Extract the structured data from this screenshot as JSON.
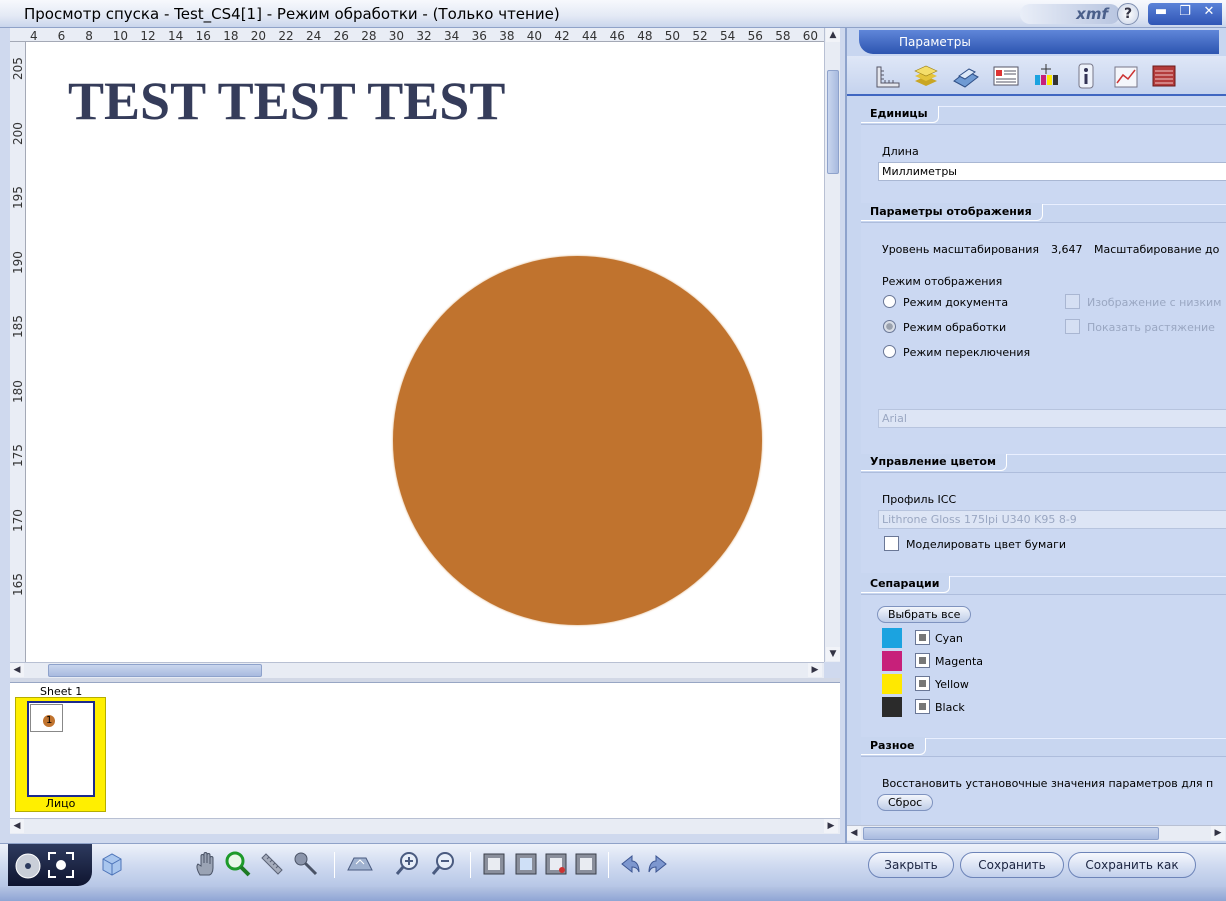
{
  "window": {
    "title": "Просмотр спуска - Test_CS4[1] - Режим обработки - (Только чтение)",
    "logo": "xmf",
    "help": "?",
    "controls": [
      "▬",
      "❐",
      "✕"
    ]
  },
  "ruler": {
    "h_ticks": [
      "4",
      "6",
      "8",
      "10",
      "12",
      "14",
      "16",
      "18",
      "20",
      "22",
      "24",
      "26",
      "28",
      "30",
      "32",
      "34",
      "36",
      "38",
      "40",
      "42",
      "44",
      "46",
      "48",
      "50",
      "52",
      "54",
      "56",
      "58",
      "60"
    ],
    "v_ticks": [
      "205",
      "200",
      "195",
      "190",
      "185",
      "180",
      "175",
      "170",
      "165"
    ]
  },
  "canvas": {
    "text": "TEST TEST TEST",
    "circle_color": "#c0732e"
  },
  "thumbs": {
    "sheet_label": "Sheet 1",
    "page_number": "1",
    "face_label": "Лицо"
  },
  "panel": {
    "tab_title": "Параметры",
    "icons": [
      "ruler-icon",
      "layers-icon",
      "printer-icon",
      "document-icon",
      "color-bars-icon",
      "info-icon",
      "chart-icon",
      "stack-icon"
    ],
    "units": {
      "title": "Единицы",
      "length_label": "Длина",
      "length_value": "Миллиметры"
    },
    "display": {
      "title": "Параметры отображения",
      "zoom_label": "Уровень масштабирования",
      "zoom_value": "3,647",
      "zoom_extra": "Масштабирование до",
      "mode_label": "Режим отображения",
      "modes": [
        "Режим документа",
        "Режим обработки",
        "Режим переключения"
      ],
      "selected_mode": "Режим обработки",
      "option_low_res": "Изображение с низким",
      "option_show_stretch": "Показать растяжение",
      "font_value": "Arial"
    },
    "color": {
      "title": "Управление цветом",
      "icc_label": "Профиль ICC",
      "icc_value": "Lithrone Gloss 175lpi U340 K95 8-9",
      "paper_color_label": "Моделировать цвет бумаги"
    },
    "separations": {
      "title": "Сепарации",
      "select_all": "Выбрать все",
      "items": [
        {
          "name": "Cyan",
          "color": "#1ba3e0"
        },
        {
          "name": "Magenta",
          "color": "#c7207a"
        },
        {
          "name": "Yellow",
          "color": "#ffe800"
        },
        {
          "name": "Black",
          "color": "#2b2b2b"
        }
      ]
    },
    "misc": {
      "title": "Разное",
      "restore_text": "Восстановить  установочные значения параметров для п",
      "reset_button": "Сброс"
    }
  },
  "bottom": {
    "close": "Закрыть",
    "save": "Сохранить",
    "save_as": "Сохранить как"
  },
  "colors": {
    "accent": "#2d55b0",
    "panel_bg": "#c8d6f0",
    "thumb_yellow": "#ffef00"
  }
}
